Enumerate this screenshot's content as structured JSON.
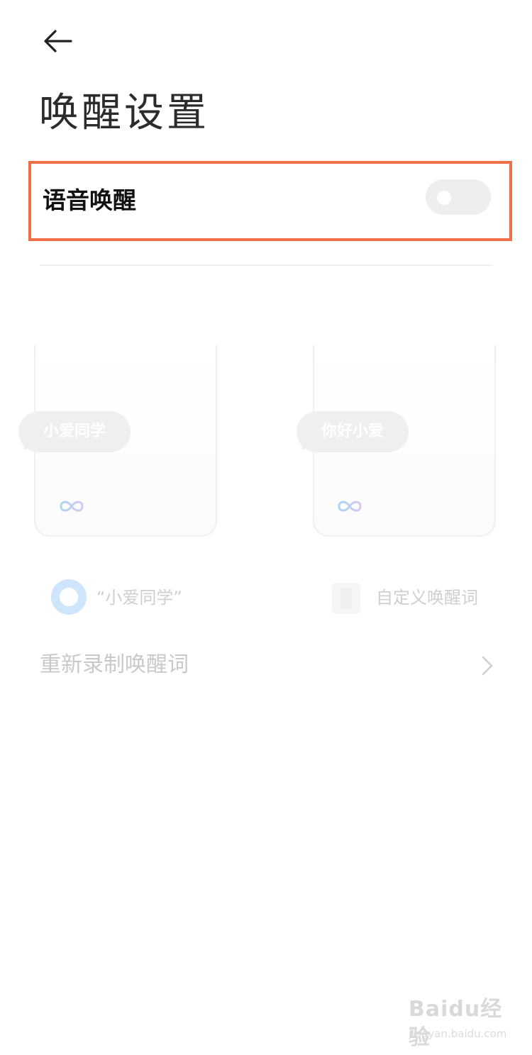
{
  "header": {
    "back_icon": "arrow-left-icon",
    "title": "唤醒设置"
  },
  "voice_wake": {
    "label": "语音唤醒",
    "enabled": false
  },
  "examples": [
    {
      "bubble_text": "小爱同学",
      "icon": "infinity-icon"
    },
    {
      "bubble_text": "你好小爱",
      "icon": "infinity-icon"
    }
  ],
  "options": [
    {
      "label": "“小爱同学”",
      "selected": true
    },
    {
      "label": "自定义唤醒词",
      "selected": false
    }
  ],
  "rerecord": {
    "label": "重新录制唤醒词",
    "icon": "chevron-right-icon"
  },
  "colors": {
    "highlight_border": "#ee7044",
    "radio_accent": "#cfe5fb"
  },
  "watermark": {
    "text": "Baidu经验",
    "sub": "jingyan.baidu.com"
  }
}
